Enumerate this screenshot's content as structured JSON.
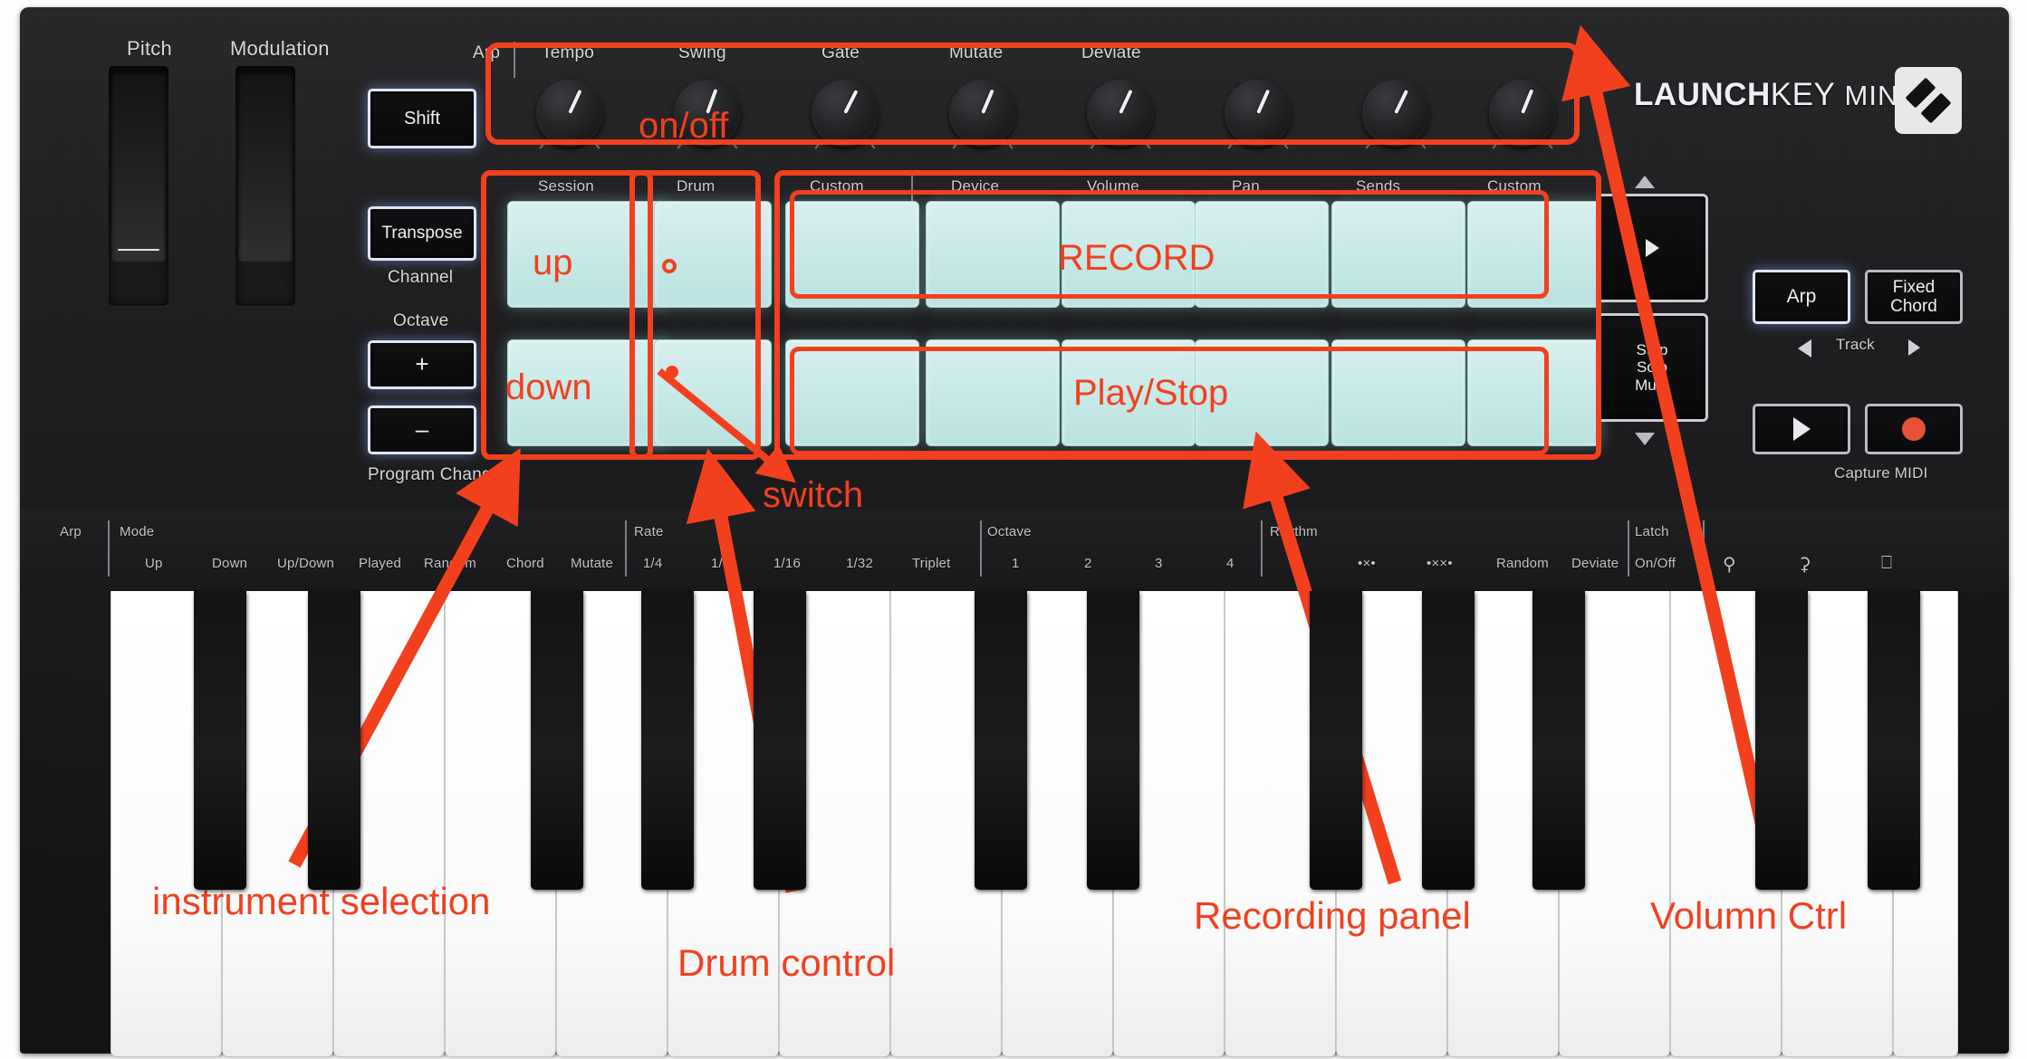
{
  "device": {
    "brand_bold": "LAUNCH",
    "brand_light": "KEY",
    "brand_mini": "MINI",
    "logo": "novation-logo-icon"
  },
  "wheels": [
    {
      "label": "Pitch"
    },
    {
      "label": "Modulation"
    }
  ],
  "left_buttons": [
    {
      "label": "Shift",
      "sub": ""
    },
    {
      "label": "Transpose",
      "sub": "Channel"
    },
    {
      "label": "+",
      "sub": ""
    },
    {
      "label": "–",
      "sub": "Program Change"
    }
  ],
  "octave_label": "Octave",
  "arp_prefix": "Arp",
  "knobs": [
    {
      "label": "Tempo",
      "angle": 205
    },
    {
      "label": "Swing",
      "angle": 200
    },
    {
      "label": "Gate",
      "angle": 207
    },
    {
      "label": "Mutate",
      "angle": 203
    },
    {
      "label": "Deviate",
      "angle": 205
    },
    {
      "label": "",
      "angle": 204
    },
    {
      "label": "",
      "angle": 206
    },
    {
      "label": "",
      "angle": 202
    }
  ],
  "pad_headers": [
    "Session",
    "Drum",
    "Custom",
    "Device",
    "Volume",
    "Pan",
    "Sends",
    "Custom"
  ],
  "nav": {
    "up_arrow": "triangle-up-icon",
    "play_nav": "play-arrow-icon",
    "stop_solo_mute": "Stop\nSolo\nMute",
    "stop_line1": "Stop",
    "stop_line2": "Solo",
    "stop_line3": "Mute",
    "down_arrow": "triangle-down-icon"
  },
  "right_buttons": {
    "arp": "Arp",
    "fixed_chord_l1": "Fixed",
    "fixed_chord_l2": "Chord",
    "track_label": "Track",
    "track_prev": "left-arrow-icon",
    "track_next": "right-arrow-icon",
    "play": "play-icon",
    "record": "record-icon",
    "capture_midi": "Capture MIDI"
  },
  "legend": {
    "arp": "Arp",
    "groups": [
      {
        "title": "Mode",
        "items": [
          "Up",
          "Down",
          "Up/Down",
          "Played",
          "Random",
          "Chord",
          "Mutate"
        ]
      },
      {
        "title": "Rate",
        "items": [
          "1/4",
          "1/8",
          "1/16",
          "1/32",
          "Triplet"
        ]
      },
      {
        "title": "Octave",
        "items": [
          "1",
          "2",
          "3",
          "4"
        ]
      },
      {
        "title": "Rhythm",
        "items": [
          "•×•",
          "•××•",
          "Random",
          "Deviate"
        ]
      },
      {
        "title": "Latch",
        "items": [
          "On/Off"
        ]
      },
      {
        "title": "",
        "items": [
          "⚲",
          "⚳",
          "⎕"
        ]
      }
    ]
  },
  "annotations": {
    "accent": "#f2401f",
    "labels": [
      {
        "id": "on-off",
        "text": "on/off"
      },
      {
        "id": "up",
        "text": "up"
      },
      {
        "id": "down",
        "text": "down"
      },
      {
        "id": "record",
        "text": "RECORD"
      },
      {
        "id": "play-stop",
        "text": "Play/Stop"
      },
      {
        "id": "switch",
        "text": "switch"
      },
      {
        "id": "instrument-selection",
        "text": "instrument selection"
      },
      {
        "id": "drum-control",
        "text": "Drum control"
      },
      {
        "id": "recording-panel",
        "text": "Recording panel"
      },
      {
        "id": "volumn-ctrl",
        "text": "Volumn Ctrl"
      }
    ]
  }
}
